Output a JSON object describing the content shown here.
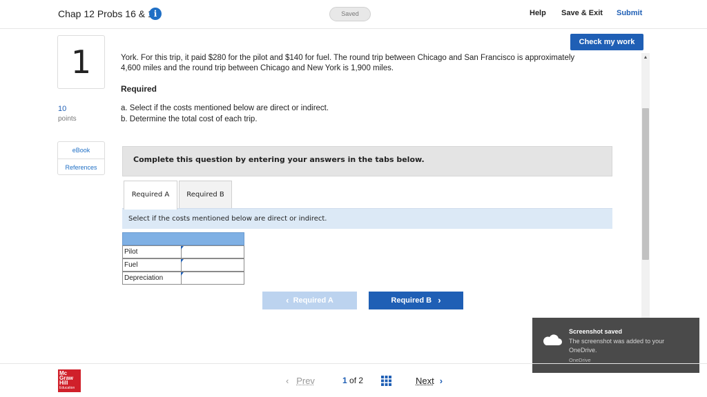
{
  "header": {
    "assignment_title": "Chap 12 Probs 16 & 17",
    "info_glyph": "i",
    "saved_status": "Saved",
    "help": "Help",
    "save_exit": "Save & Exit",
    "submit": "Submit"
  },
  "question": {
    "number": "1",
    "points_value": "10",
    "points_label": "points",
    "resources": [
      "eBook",
      "References"
    ],
    "text_line_1": "York. For this trip, it paid $280 for the pilot and $140 for fuel. The round trip between Chicago and San Francisco is approximately",
    "text_line_2": "4,600 miles and the round trip between Chicago and New York is 1,900 miles.",
    "required_heading": "Required",
    "required_a": "a. Select if the costs mentioned below are direct or indirect.",
    "required_b": "b. Determine the total cost of each trip."
  },
  "check_my_work": "Check my work",
  "complete_box": "Complete this question by entering your answers in the tabs below.",
  "tabs": [
    {
      "label": "Required A",
      "active": true
    },
    {
      "label": "Required B",
      "active": false
    }
  ],
  "instruction": "Select if the costs mentioned below are direct or indirect.",
  "answer_table": {
    "rows": [
      {
        "label": "Pilot",
        "value": ""
      },
      {
        "label": "Fuel",
        "value": ""
      },
      {
        "label": "Depreciation",
        "value": ""
      }
    ]
  },
  "nav_buttons": {
    "prev_label": "Required A",
    "next_label": "Required B",
    "prev_chevron": "‹",
    "next_chevron": "›"
  },
  "toast": {
    "title": "Screenshot saved",
    "body": "The screenshot was added to your OneDrive.",
    "source": "OneDrive"
  },
  "footer": {
    "logo_lines": [
      "Mc",
      "Graw",
      "Hill",
      "Education"
    ],
    "prev": "Prev",
    "page_current": "1",
    "page_of": "of",
    "page_total": "2",
    "next": "Next",
    "prev_arrow": "‹",
    "next_arrow": "›"
  },
  "colors": {
    "brand_blue": "#1f5fb5",
    "tab_bar_blue": "#dce9f6",
    "table_header_blue": "#7fb0e4",
    "logo_red": "#d0202a",
    "toast_bg": "#4a4a4a"
  },
  "icons": [
    "info-icon",
    "cloud-icon",
    "grid-icon",
    "chevron-left-icon",
    "chevron-right-icon",
    "scroll-up-icon"
  ]
}
